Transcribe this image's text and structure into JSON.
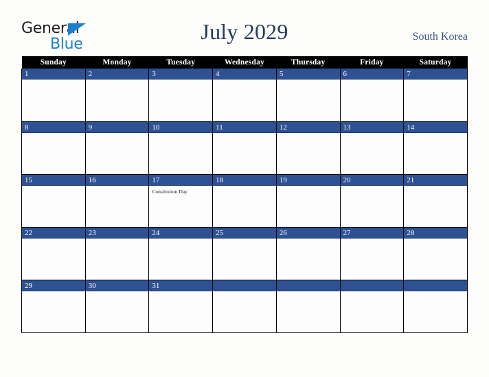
{
  "brand": {
    "name_top": "General",
    "name_bottom": "Blue",
    "top_color": "#231f20",
    "bottom_color": "#1b80cf"
  },
  "header": {
    "title": "July 2029",
    "title_color": "#27395e",
    "region": "South Korea",
    "region_color": "#3c4f77"
  },
  "calendar": {
    "accent_blue": "#2d5193",
    "header_bg": "#000000",
    "cell_bg": "#fdfdfd",
    "weekdays": [
      "Sunday",
      "Monday",
      "Tuesday",
      "Wednesday",
      "Thursday",
      "Friday",
      "Saturday"
    ],
    "weeks": [
      [
        {
          "day": "1",
          "events": []
        },
        {
          "day": "2",
          "events": []
        },
        {
          "day": "3",
          "events": []
        },
        {
          "day": "4",
          "events": []
        },
        {
          "day": "5",
          "events": []
        },
        {
          "day": "6",
          "events": []
        },
        {
          "day": "7",
          "events": []
        }
      ],
      [
        {
          "day": "8",
          "events": []
        },
        {
          "day": "9",
          "events": []
        },
        {
          "day": "10",
          "events": []
        },
        {
          "day": "11",
          "events": []
        },
        {
          "day": "12",
          "events": []
        },
        {
          "day": "13",
          "events": []
        },
        {
          "day": "14",
          "events": []
        }
      ],
      [
        {
          "day": "15",
          "events": []
        },
        {
          "day": "16",
          "events": []
        },
        {
          "day": "17",
          "events": [
            "Constitution Day"
          ]
        },
        {
          "day": "18",
          "events": []
        },
        {
          "day": "19",
          "events": []
        },
        {
          "day": "20",
          "events": []
        },
        {
          "day": "21",
          "events": []
        }
      ],
      [
        {
          "day": "22",
          "events": []
        },
        {
          "day": "23",
          "events": []
        },
        {
          "day": "24",
          "events": []
        },
        {
          "day": "25",
          "events": []
        },
        {
          "day": "26",
          "events": []
        },
        {
          "day": "27",
          "events": []
        },
        {
          "day": "28",
          "events": []
        }
      ],
      [
        {
          "day": "29",
          "events": []
        },
        {
          "day": "30",
          "events": []
        },
        {
          "day": "31",
          "events": []
        },
        {
          "day": "",
          "events": []
        },
        {
          "day": "",
          "events": []
        },
        {
          "day": "",
          "events": []
        },
        {
          "day": "",
          "events": []
        }
      ]
    ]
  }
}
